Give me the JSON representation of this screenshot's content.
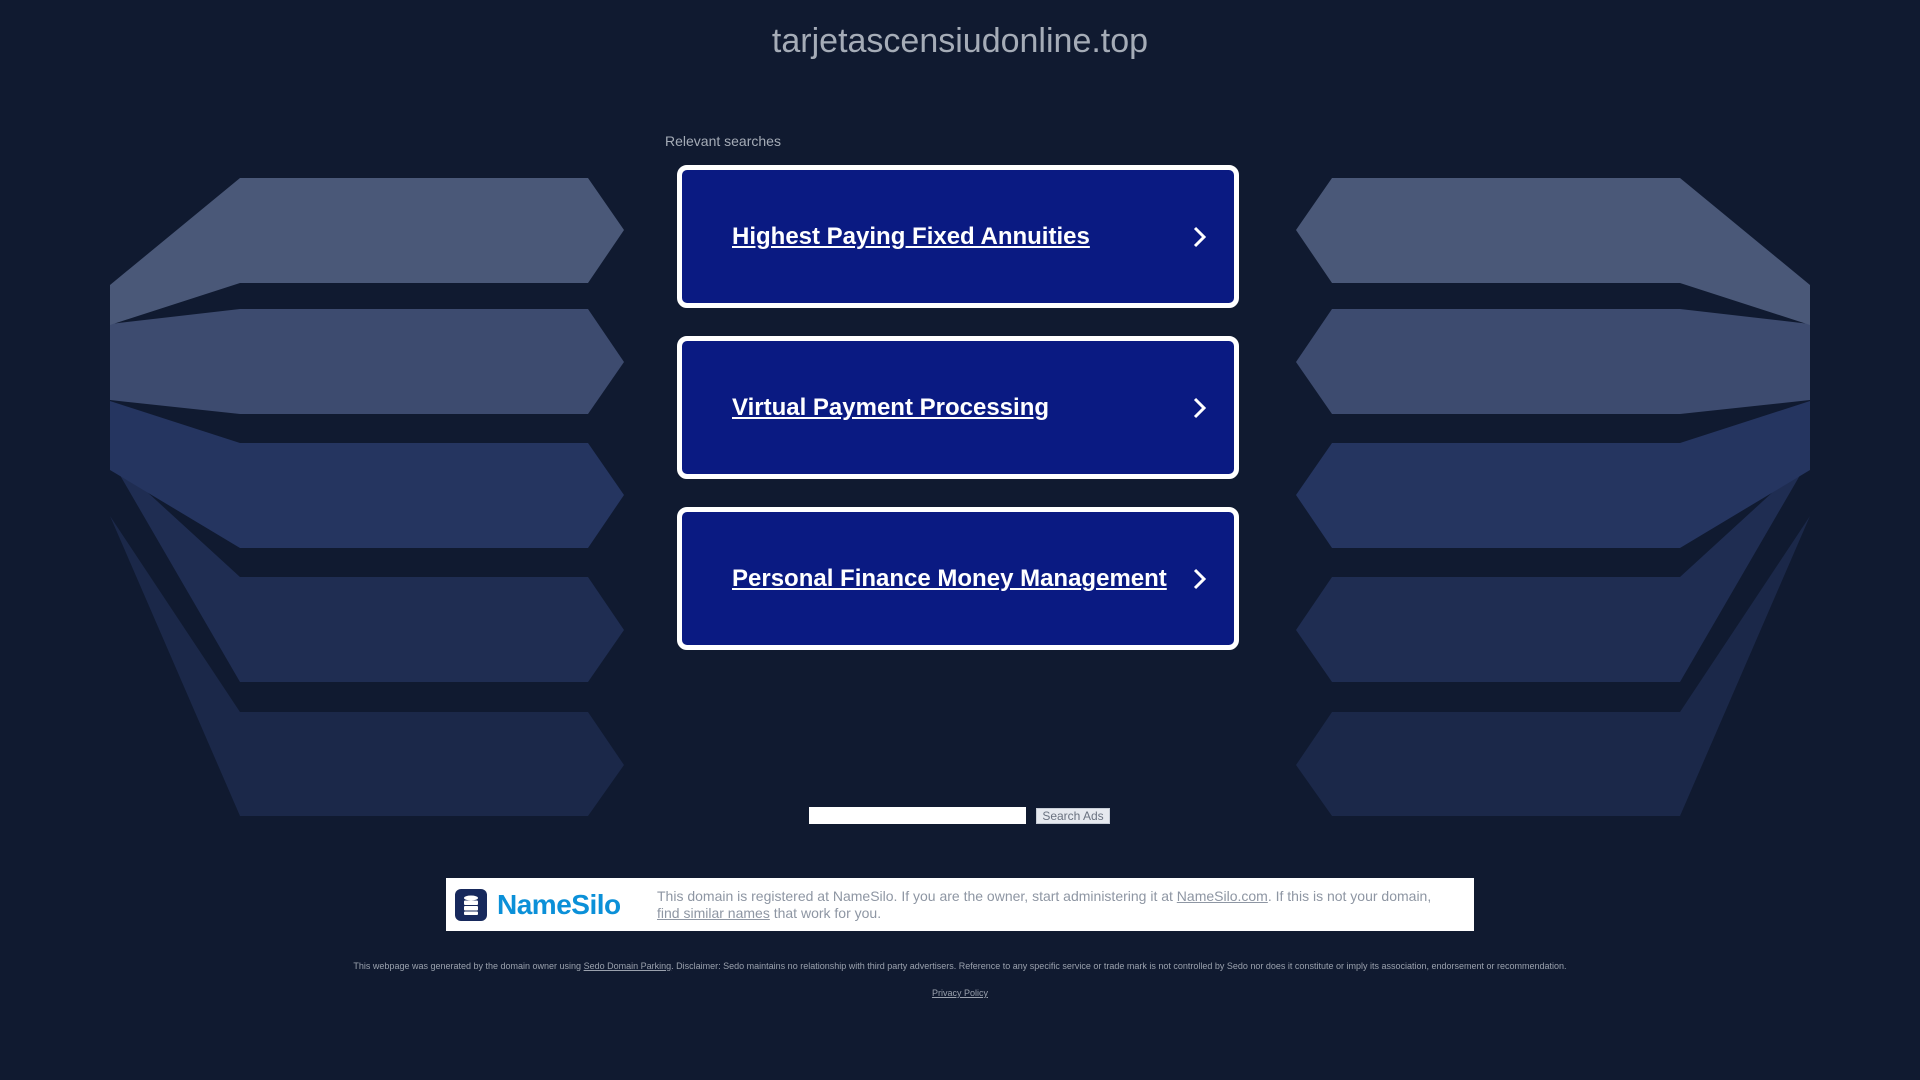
{
  "header": {
    "domain": "tarjetascensiudonline.top"
  },
  "searches": {
    "heading": "Relevant searches",
    "items": [
      {
        "label": "Highest Paying Fixed Annuities"
      },
      {
        "label": "Virtual Payment Processing"
      },
      {
        "label": "Personal Finance Money Management"
      }
    ]
  },
  "search_box": {
    "value": "",
    "button_label": "Search Ads"
  },
  "namesilo": {
    "logo_text": "NameSilo",
    "text_1": "This domain is registered at NameSilo. If you are the owner, start administering it at ",
    "link_1": "NameSilo.com",
    "text_2": ". If this is not your domain,",
    "link_2": "find similar names",
    "text_3": " that work for you."
  },
  "footer": {
    "disclaimer_pre": "This webpage was generated by the domain owner using ",
    "disclaimer_link": "Sedo Domain Parking",
    "disclaimer_post": ". Disclaimer: Sedo maintains no relationship with third party advertisers. Reference to any specific service or trade mark is not controlled by Sedo nor does it constitute or imply its association, endorsement or recommendation.",
    "privacy_label": "Privacy Policy"
  },
  "colors": {
    "background": "#101a30",
    "card_fill": "#0a1a82",
    "card_border": "#ffffff",
    "muted_text": "#a5acb7",
    "namesilo_blue": "#0b90d8",
    "namesilo_navy": "#17295c"
  }
}
